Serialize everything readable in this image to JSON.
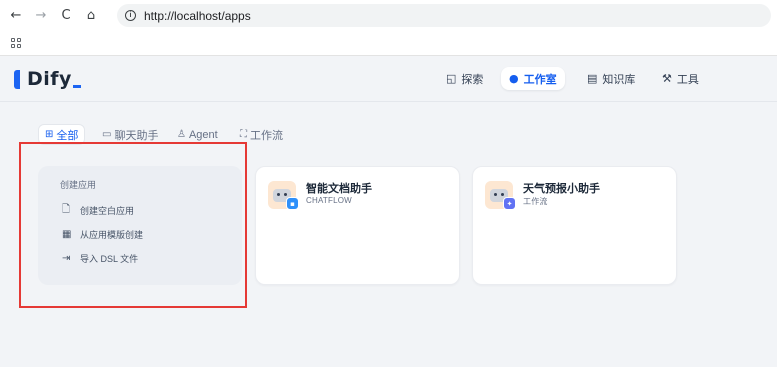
{
  "browser": {
    "back_icon": "←",
    "forward_icon": "→",
    "reload_icon": "C",
    "home_icon": "⌂",
    "info_icon": "i",
    "url": "http://localhost/apps"
  },
  "app": {
    "logo_text": "Dify",
    "brand_color": "#1c64f2",
    "accent_color": "#155eef"
  },
  "header_nav": [
    {
      "label": "探索",
      "icon": "explore-icon",
      "active": false
    },
    {
      "label": "工作室",
      "icon": "robot-icon",
      "active": true
    },
    {
      "label": "知识库",
      "icon": "book-icon",
      "active": false
    },
    {
      "label": "工具",
      "icon": "hammer-icon",
      "active": false
    }
  ],
  "tabs": [
    {
      "label": "全部",
      "icon": "grid-icon",
      "active": true
    },
    {
      "label": "聊天助手",
      "icon": "chat-icon",
      "active": false
    },
    {
      "label": "Agent",
      "icon": "agent-icon",
      "active": false
    },
    {
      "label": "工作流",
      "icon": "workflow-icon",
      "active": false
    }
  ],
  "create": {
    "title": "创建应用",
    "items": [
      {
        "label": "创建空白应用",
        "icon": "file-plus-icon"
      },
      {
        "label": "从应用模版创建",
        "icon": "template-icon"
      },
      {
        "label": "导入 DSL 文件",
        "icon": "import-icon"
      }
    ]
  },
  "apps": [
    {
      "name": "智能文档助手",
      "type": "CHATFLOW",
      "badge_icon": "chat-badge-icon"
    },
    {
      "name": "天气预报小助手",
      "type": "工作流",
      "badge_icon": "workflow-badge-icon"
    }
  ]
}
